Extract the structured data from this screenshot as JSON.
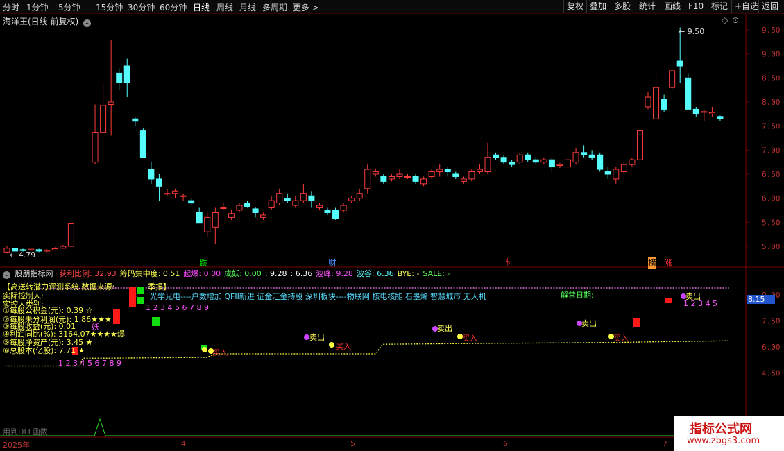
{
  "toolbar": {
    "periods": [
      "分时",
      "1分钟",
      "5分钟",
      "15分钟",
      "30分钟",
      "60分钟",
      "日线",
      "周线",
      "月线",
      "多周期",
      "更多 >"
    ],
    "active_period": "日线",
    "right_buttons": [
      "复权",
      "叠加",
      "多股",
      "统计",
      "画线",
      "F10",
      "+自选",
      "返回"
    ],
    "extra_button": "标记"
  },
  "main_chart": {
    "title": "海洋王(日线 前复权)",
    "high_label": "9.50",
    "low_label": "4.79",
    "y_ticks": [
      "9.50",
      "9.00",
      "8.50",
      "8.00",
      "7.50",
      "7.00",
      "6.50",
      "6.00",
      "5.50",
      "5.00"
    ],
    "markers": [
      {
        "text": "跌",
        "color": "#00dd00"
      },
      {
        "text": "财",
        "color": "#4a8cff"
      },
      {
        "text": "$",
        "color": "#ff3333"
      },
      {
        "text": "榜",
        "color": "#ff9933"
      },
      {
        "text": "涨",
        "color": "#ff3333"
      }
    ]
  },
  "chart_data": {
    "type": "candlestick",
    "ylim": [
      4.75,
      9.75
    ],
    "candles": [
      [
        4.88,
        4.96,
        4.85,
        5.0
      ],
      [
        4.95,
        4.9,
        4.88,
        4.97
      ],
      [
        4.93,
        4.91,
        4.89,
        4.95
      ],
      [
        4.92,
        4.94,
        4.9,
        4.96
      ],
      [
        4.93,
        4.9,
        4.88,
        4.95
      ],
      [
        4.9,
        4.92,
        4.88,
        4.94
      ],
      [
        4.92,
        4.95,
        4.91,
        4.98
      ],
      [
        4.96,
        5.0,
        4.95,
        5.03
      ],
      [
        5.0,
        5.47,
        4.98,
        5.48
      ],
      [
        6.75,
        7.37,
        6.71,
        7.95
      ],
      [
        7.37,
        7.93,
        7.35,
        8.4
      ],
      [
        7.95,
        8.0,
        7.3,
        9.3
      ],
      [
        8.6,
        8.4,
        8.25,
        8.7
      ],
      [
        8.75,
        8.4,
        8.1,
        8.9
      ],
      [
        7.65,
        7.6,
        7.5,
        7.68
      ],
      [
        7.4,
        6.85,
        6.85,
        7.45
      ],
      [
        6.6,
        6.4,
        6.3,
        6.75
      ],
      [
        6.4,
        6.25,
        5.95,
        6.5
      ],
      [
        6.1,
        6.1,
        6.05,
        6.2
      ],
      [
        6.1,
        6.15,
        6.0,
        6.2
      ],
      [
        6.05,
        6.05,
        5.95,
        6.1
      ],
      [
        5.95,
        5.9,
        5.85,
        6.0
      ],
      [
        5.7,
        5.48,
        5.48,
        5.8
      ],
      [
        5.3,
        5.6,
        5.2,
        5.7
      ],
      [
        5.4,
        5.7,
        5.05,
        5.8
      ],
      [
        5.8,
        5.8,
        5.75,
        5.9
      ],
      [
        5.6,
        5.68,
        5.55,
        5.75
      ],
      [
        5.75,
        5.85,
        5.7,
        5.9
      ],
      [
        5.9,
        5.82,
        5.8,
        5.95
      ],
      [
        5.78,
        5.7,
        5.6,
        5.82
      ],
      [
        5.6,
        5.65,
        5.55,
        5.7
      ],
      [
        5.8,
        5.95,
        5.75,
        6.05
      ],
      [
        5.9,
        6.1,
        5.85,
        6.2
      ],
      [
        6.0,
        5.95,
        5.9,
        6.1
      ],
      [
        5.85,
        5.95,
        5.8,
        6.05
      ],
      [
        5.95,
        6.1,
        5.9,
        6.3
      ],
      [
        6.05,
        5.95,
        5.8,
        6.15
      ],
      [
        5.8,
        5.85,
        5.75,
        5.9
      ],
      [
        5.75,
        5.7,
        5.65,
        5.8
      ],
      [
        5.75,
        5.58,
        5.55,
        5.8
      ],
      [
        5.75,
        5.85,
        5.7,
        5.9
      ],
      [
        5.95,
        6.0,
        5.9,
        6.05
      ],
      [
        6.0,
        6.1,
        5.95,
        6.2
      ],
      [
        6.2,
        6.6,
        6.1,
        6.7
      ],
      [
        6.5,
        6.55,
        6.45,
        6.62
      ],
      [
        6.45,
        6.35,
        6.3,
        6.5
      ],
      [
        6.4,
        6.45,
        6.35,
        6.5
      ],
      [
        6.45,
        6.5,
        6.4,
        6.6
      ],
      [
        6.45,
        6.45,
        6.4,
        6.5
      ],
      [
        6.45,
        6.35,
        6.3,
        6.5
      ],
      [
        6.3,
        6.4,
        6.25,
        6.45
      ],
      [
        6.45,
        6.55,
        6.4,
        6.6
      ],
      [
        6.55,
        6.6,
        6.45,
        6.7
      ],
      [
        6.6,
        6.55,
        6.45,
        6.65
      ],
      [
        6.5,
        6.45,
        6.4,
        6.55
      ],
      [
        6.35,
        6.4,
        6.3,
        6.45
      ],
      [
        6.4,
        6.55,
        6.35,
        6.6
      ],
      [
        6.55,
        6.6,
        6.5,
        6.7
      ],
      [
        6.55,
        6.85,
        6.5,
        7.15
      ],
      [
        6.9,
        6.85,
        6.8,
        6.95
      ],
      [
        6.85,
        6.75,
        6.7,
        6.9
      ],
      [
        6.75,
        6.7,
        6.65,
        6.8
      ],
      [
        6.75,
        6.9,
        6.7,
        6.95
      ],
      [
        6.9,
        6.8,
        6.75,
        6.95
      ],
      [
        6.8,
        6.75,
        6.7,
        6.85
      ],
      [
        6.75,
        6.8,
        6.7,
        6.85
      ],
      [
        6.8,
        6.65,
        6.55,
        6.85
      ],
      [
        6.68,
        6.7,
        6.63,
        6.73
      ],
      [
        6.65,
        6.8,
        6.6,
        6.85
      ],
      [
        6.75,
        6.95,
        6.7,
        7.05
      ],
      [
        6.95,
        6.9,
        6.85,
        7.1
      ],
      [
        6.9,
        6.85,
        6.8,
        7.0
      ],
      [
        6.9,
        6.6,
        6.55,
        6.95
      ],
      [
        6.55,
        6.5,
        6.4,
        6.65
      ],
      [
        6.4,
        6.6,
        6.3,
        6.65
      ],
      [
        6.55,
        6.7,
        6.5,
        6.75
      ],
      [
        6.7,
        6.8,
        6.65,
        6.85
      ],
      [
        6.8,
        7.4,
        6.75,
        7.45
      ],
      [
        7.9,
        8.1,
        7.85,
        8.2
      ],
      [
        7.65,
        8.3,
        7.6,
        8.65
      ],
      [
        8.05,
        7.85,
        7.8,
        8.15
      ],
      [
        8.3,
        8.65,
        8.25,
        8.65
      ],
      [
        8.85,
        8.75,
        8.4,
        9.55
      ],
      [
        8.5,
        7.85,
        7.85,
        8.6
      ],
      [
        7.85,
        7.75,
        7.7,
        7.9
      ],
      [
        7.8,
        7.8,
        7.6,
        7.85
      ],
      [
        7.75,
        7.78,
        7.7,
        7.9
      ],
      [
        7.7,
        7.65,
        7.6,
        7.72
      ]
    ],
    "candle_gaps": [
      {
        "after": 8,
        "slots": 2
      }
    ],
    "indicator": {
      "name": "股朋指标网",
      "y_ticks": [
        "9.00",
        "7.50",
        "6.00",
        "4.50"
      ],
      "ylim": [
        4.0,
        10.0
      ],
      "current_value": "8.15",
      "yellow_dotted_line": [
        [
          0,
          4.9
        ],
        [
          22,
          4.9
        ],
        [
          23,
          5.35
        ],
        [
          30,
          5.35
        ],
        [
          60,
          5.4
        ],
        [
          62,
          5.6
        ],
        [
          70,
          5.6
        ],
        [
          110,
          5.6
        ],
        [
          112,
          6.15
        ],
        [
          140,
          6.2
        ],
        [
          180,
          6.25
        ],
        [
          195,
          6.3
        ],
        [
          215,
          6.35
        ]
      ],
      "pink_dotted_line": [
        [
          9.4,
          9.35
        ],
        [
          32,
          9.4
        ],
        [
          215,
          9.4
        ]
      ]
    }
  },
  "indicator_row": {
    "title": "股朋指标网",
    "items": [
      {
        "label": "获利比例:",
        "value": "32.93",
        "color": "#ff4444"
      },
      {
        "label": "筹码集中度:",
        "value": "0.51",
        "color": "#ffff55"
      },
      {
        "label": "起爆:",
        "value": "0.00",
        "color": "#ff44ff"
      },
      {
        "label": "成妖:",
        "value": "0.00",
        "color": "#55ff55"
      },
      {
        "label": ":",
        "value": "9.28",
        "color": "#ffffff"
      },
      {
        "label": ":",
        "value": "6.36",
        "color": "#ffffff"
      },
      {
        "label": "波峰:",
        "value": "9.28",
        "color": "#ff55ff"
      },
      {
        "label": "波谷:",
        "value": "6.36",
        "color": "#55ffff"
      },
      {
        "label": "BYE:",
        "value": "-",
        "color": "#ffff55"
      },
      {
        "label": "SALE:",
        "value": "-",
        "color": "#55ff55"
      }
    ]
  },
  "indicator_panel": {
    "header": "【高送转潜力评测系统  数据来源:",
    "header2": "季报】",
    "lines": [
      "实际控制人:",
      "实控人类别:",
      "①每股公积金(元): 0.39 ☆",
      "②每股未分利润(元): 1.86★★★",
      "③每股收益(元): 0.01",
      "④利润同比(%): 3164.07★★★★爆",
      "⑤每股净资产(元): 3.45 ★",
      "⑥总股本(亿股): 7.71 ★"
    ],
    "yao_text": "妖",
    "concepts": "光学光电----户数增加 QFII新进 证金汇金持股 深圳板块----物联网 核电核能 石墨烯 智慧城市 无人机",
    "jiejin": "解禁日期:",
    "seq1": "1 2 3 4 5 6 7 8 9",
    "seq2": "1 2 3 4 5 6 7 8 9",
    "seq3": "1 2 3 4 5",
    "buy_label": "买入",
    "sell_label": "卖出"
  },
  "bottom_axis": {
    "year_label": "2025年",
    "month_labels": [
      "4",
      "5",
      "6",
      "7"
    ],
    "sub_indicator": "用到DLL函数"
  },
  "watermark": {
    "line1": "指标公式网",
    "line2": "www.zbgs3.com"
  }
}
